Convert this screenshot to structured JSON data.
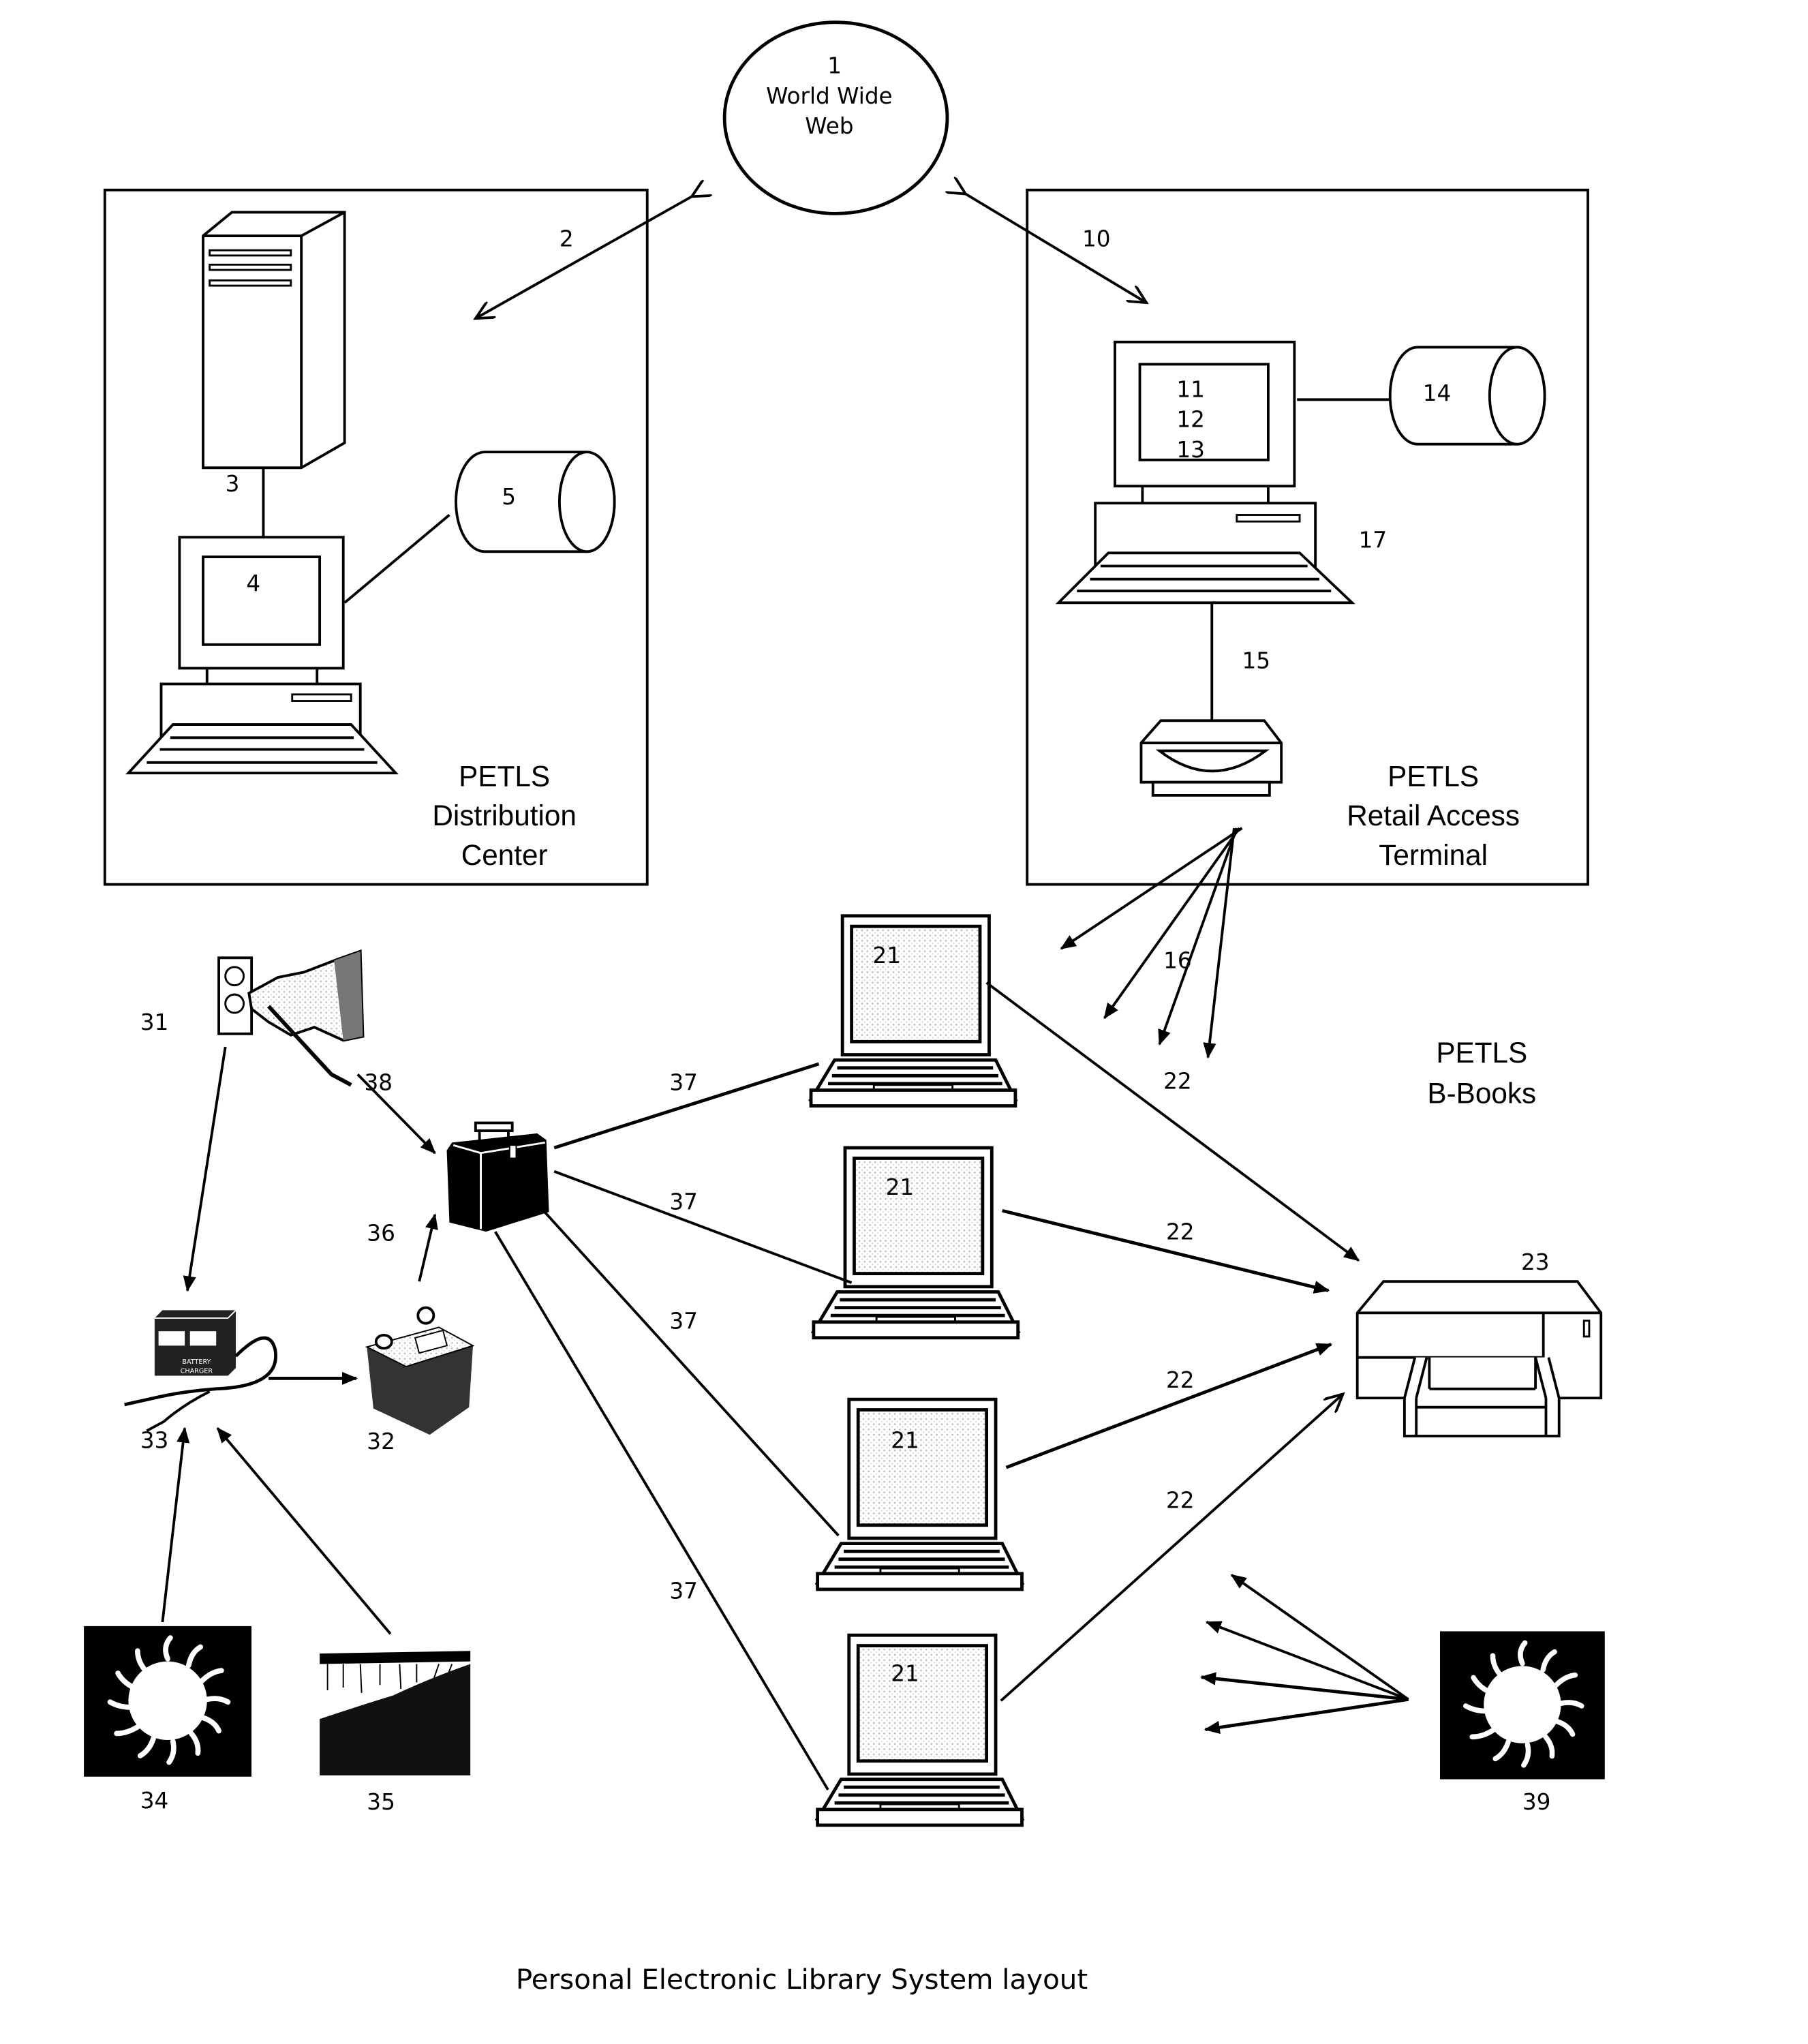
{
  "caption": "Personal Electronic Library System layout",
  "web": {
    "number": "1",
    "line1": "World Wide",
    "line2": "Web"
  },
  "distribution_center": {
    "title": [
      "PETLS",
      "Distribution",
      "Center"
    ],
    "server_label": "3",
    "computer_label": "4",
    "storage_label": "5",
    "link_label": "2"
  },
  "retail_terminal": {
    "title": [
      "PETLS",
      "Retail Access",
      "Terminal"
    ],
    "screen_labels": [
      "11",
      "12",
      "13"
    ],
    "storage_label": "14",
    "cable_label": "15",
    "computer_label": "17",
    "link_label": "10",
    "wireless_label": "16",
    "wireless_target_label": "22"
  },
  "bbooks": {
    "title": [
      "PETLS",
      "B-Books"
    ],
    "device_label": "21",
    "print_link_label": "22",
    "printer_label": "23",
    "charge_link_label": "37"
  },
  "power": {
    "outlet_label": "31",
    "battery_label": "32",
    "charger_label": "33",
    "solar_label": "34",
    "hydro_label": "35",
    "battery_link_label": "36",
    "outlet_link_label": "38",
    "solar_wireless_label": "39",
    "charger_text": [
      "BATTERY",
      "CHARGER"
    ]
  }
}
